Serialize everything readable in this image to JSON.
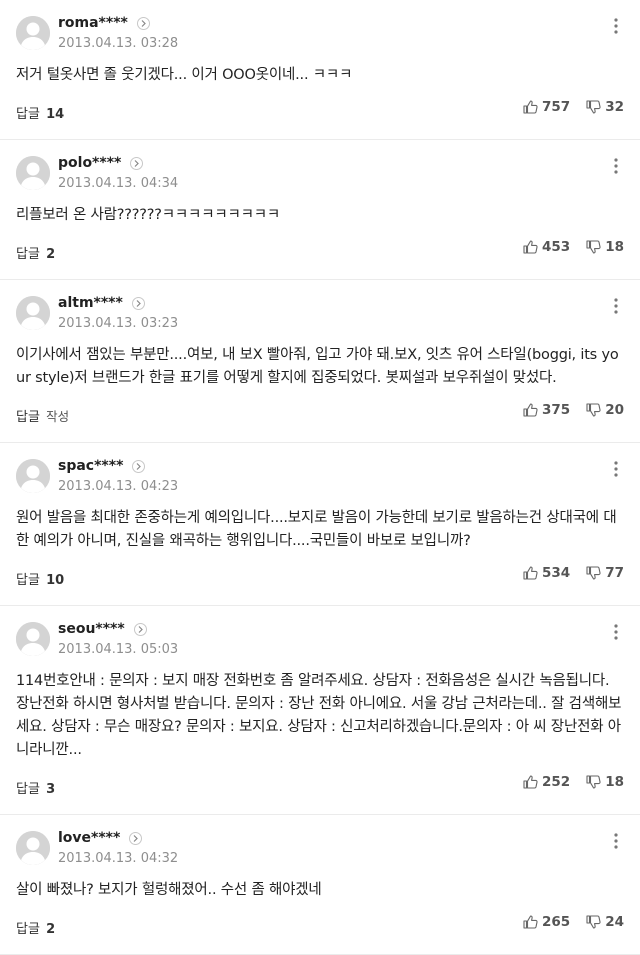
{
  "labels": {
    "reply": "답글",
    "write": "작성"
  },
  "comments": [
    {
      "nick": "roma****",
      "date": "2013.04.13. 03:28",
      "text": "저거 털옷사면 졸 웃기겠다... 이거 OOO옷이네... ㅋㅋㅋ",
      "replies": "14",
      "likes": "757",
      "dislikes": "32"
    },
    {
      "nick": "polo****",
      "date": "2013.04.13. 04:34",
      "text": "리플보러 온 사람??????ㅋㅋㅋㅋㅋㅋㅋㅋㅋ",
      "replies": "2",
      "likes": "453",
      "dislikes": "18"
    },
    {
      "nick": "altm****",
      "date": "2013.04.13. 03:23",
      "text": "이기사에서 잼있는 부분만....여보, 내 보X 빨아줘, 입고 가야 돼.보X, 잇츠 유어 스타일(boggi, its your style)저 브랜드가 한글 표기를 어떻게 할지에 집중되었다. 봇찌설과 보우쥐설이 맞섰다.",
      "replies": "",
      "likes": "375",
      "dislikes": "20"
    },
    {
      "nick": "spac****",
      "date": "2013.04.13. 04:23",
      "text": "원어 발음을 최대한 존중하는게 예의입니다....보지로 발음이 가능한데 보기로 발음하는건 상대국에 대한 예의가 아니며, 진실을 왜곡하는 행위입니다....국민들이 바보로 보입니까?",
      "replies": "10",
      "likes": "534",
      "dislikes": "77"
    },
    {
      "nick": "seou****",
      "date": "2013.04.13. 05:03",
      "text": "114번호안내 : 문의자 : 보지 매장 전화번호 좀 알려주세요. 상담자 : 전화음성은 실시간 녹음됩니다. 장난전화 하시면 형사처벌 받습니다. 문의자 : 장난 전화 아니에요. 서울 강남 근처라는데.. 잘 검색해보세요. 상담자 : 무슨 매장요? 문의자 : 보지요. 상담자 : 신고처리하겠습니다.문의자 : 아 씨 장난전화 아니라니깐...",
      "replies": "3",
      "likes": "252",
      "dislikes": "18"
    },
    {
      "nick": "love****",
      "date": "2013.04.13. 04:32",
      "text": "살이 빠졌나? 보지가 헐렁해졌어.. 수선 좀 해야겠네",
      "replies": "2",
      "likes": "265",
      "dislikes": "24"
    }
  ]
}
